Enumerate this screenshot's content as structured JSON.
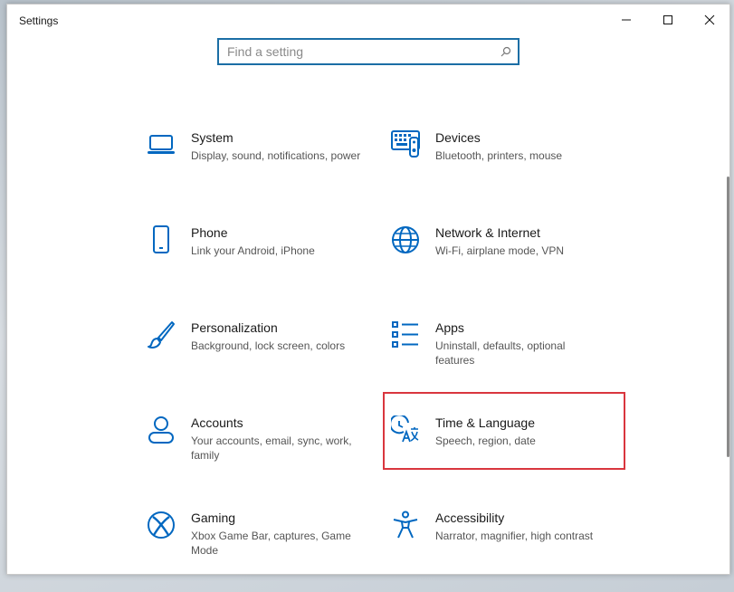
{
  "window": {
    "title": "Settings"
  },
  "search": {
    "placeholder": "Find a setting"
  },
  "categories": [
    {
      "name": "System",
      "desc": "Display, sound, notifications, power",
      "icon": "laptop-icon"
    },
    {
      "name": "Devices",
      "desc": "Bluetooth, printers, mouse",
      "icon": "keyboard-icon"
    },
    {
      "name": "Phone",
      "desc": "Link your Android, iPhone",
      "icon": "phone-icon"
    },
    {
      "name": "Network & Internet",
      "desc": "Wi-Fi, airplane mode, VPN",
      "icon": "globe-icon"
    },
    {
      "name": "Personalization",
      "desc": "Background, lock screen, colors",
      "icon": "paint-brush-icon"
    },
    {
      "name": "Apps",
      "desc": "Uninstall, defaults, optional features",
      "icon": "apps-list-icon"
    },
    {
      "name": "Accounts",
      "desc": "Your accounts, email, sync, work, family",
      "icon": "person-icon"
    },
    {
      "name": "Time & Language",
      "desc": "Speech, region, date",
      "icon": "time-language-icon"
    },
    {
      "name": "Gaming",
      "desc": "Xbox Game Bar, captures, Game Mode",
      "icon": "xbox-icon"
    },
    {
      "name": "Accessibility",
      "desc": "Narrator, magnifier, high contrast",
      "icon": "accessibility-icon"
    }
  ],
  "colors": {
    "accent": "#0067c0",
    "search_border": "#1b6ea5",
    "highlight": "#d9363e"
  }
}
